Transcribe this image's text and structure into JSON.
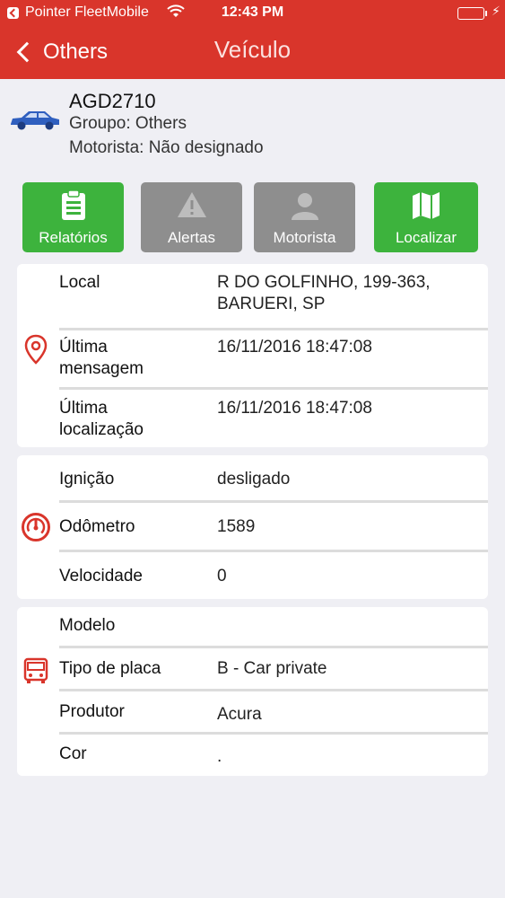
{
  "status_bar": {
    "carrier": "Pointer FleetMobile",
    "time": "12:43 PM"
  },
  "nav": {
    "back_label": "Others",
    "title": "Veículo"
  },
  "vehicle": {
    "plate": "AGD2710",
    "group": "Groupo: Others",
    "driver": "Motorista: Não designado"
  },
  "actions": [
    {
      "label": "Relatórios",
      "icon": "clipboard-icon",
      "color": "#3db33d"
    },
    {
      "label": "Alertas",
      "icon": "warning-icon",
      "color": "#8e8e8e"
    },
    {
      "label": "Motorista",
      "icon": "person-icon",
      "color": "#8e8e8e"
    },
    {
      "label": "Localizar",
      "icon": "map-icon",
      "color": "#3db33d"
    }
  ],
  "location_card": {
    "icon": "location-pin-icon",
    "rows": [
      {
        "key": "Local",
        "value": "R DO GOLFINHO, 199-363, BARUERI, SP"
      },
      {
        "key": "Última mensagem",
        "value": "16/11/2016 18:47:08"
      },
      {
        "key": "Última localização",
        "value": "16/11/2016 18:47:08"
      }
    ]
  },
  "status_card": {
    "icon": "speedometer-icon",
    "rows": [
      {
        "key": "Ignição",
        "value": "desligado"
      },
      {
        "key": "Odômetro",
        "value": "1589"
      },
      {
        "key": "Velocidade",
        "value": "0"
      }
    ]
  },
  "details_card": {
    "icon": "bus-icon",
    "rows": [
      {
        "key": "Modelo",
        "value": ""
      },
      {
        "key": "Tipo de placa",
        "value": "B - Car private"
      },
      {
        "key": "Produtor",
        "value": "Acura"
      },
      {
        "key": "Cor",
        "value": "."
      }
    ]
  },
  "colors": {
    "header": "#d9352b",
    "accent_icon": "#d9352b",
    "vehicle_icon": "#2f5fbf"
  }
}
